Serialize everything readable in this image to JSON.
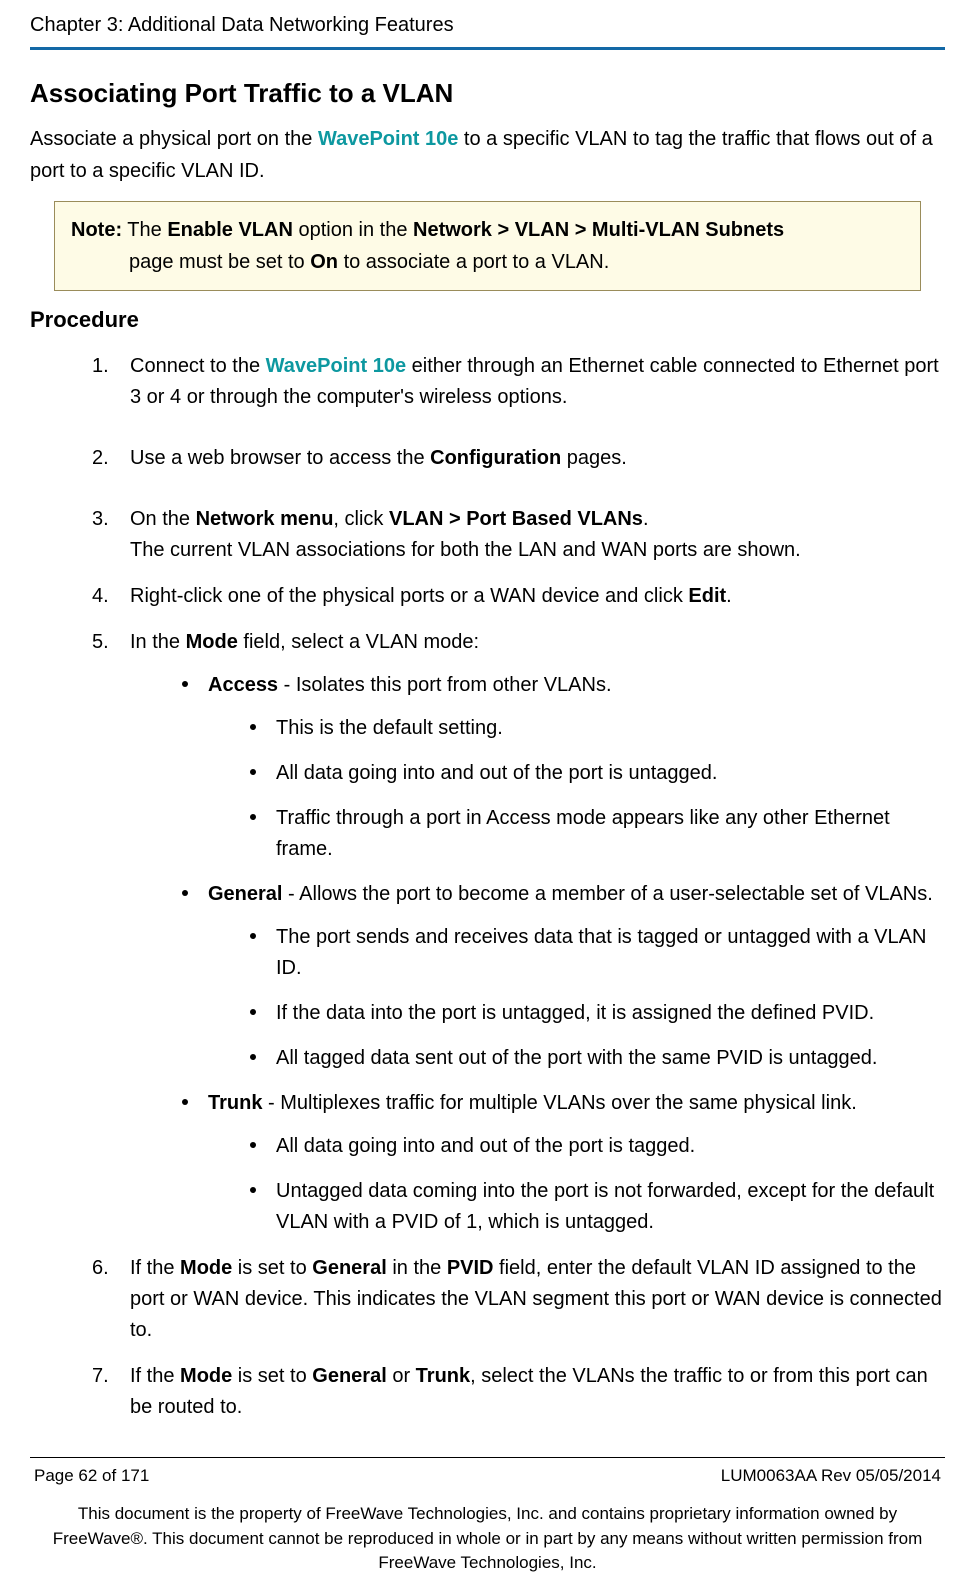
{
  "header": {
    "chapter": "Chapter 3: Additional Data Networking Features"
  },
  "section": {
    "title": "Associating Port Traffic to a VLAN",
    "intro_pre": "Associate a physical port on the ",
    "intro_link": "WavePoint 10e",
    "intro_post": " to a specific VLAN to tag the traffic that flows out of a port to a specific VLAN ID."
  },
  "note": {
    "label": "Note:",
    "line1_a": " The ",
    "line1_b": "Enable VLAN",
    "line1_c": " option in the ",
    "line1_d": "Network > VLAN > Multi-VLAN Subnets",
    "line2_a": "page must be set to ",
    "line2_b": "On",
    "line2_c": " to associate a port to a VLAN."
  },
  "procedure": {
    "title": "Procedure",
    "steps": {
      "s1": {
        "num": "1.",
        "a": "Connect to the ",
        "link": "WavePoint 10e",
        "b": " either through an Ethernet cable connected to Ethernet port 3 or 4 or through the computer's wireless options."
      },
      "s2": {
        "num": "2.",
        "a": "Use a web browser to access the ",
        "b": "Configuration",
        "c": " pages."
      },
      "s3": {
        "num": "3.",
        "a": "On the ",
        "b": "Network menu",
        "c": ", click ",
        "d": "VLAN > Port Based VLANs",
        "e": ".",
        "line2": "The current VLAN associations for both the LAN and WAN ports are shown."
      },
      "s4": {
        "num": "4.",
        "a": "Right-click one of the physical ports or a WAN device and click ",
        "b": "Edit",
        "c": "."
      },
      "s5": {
        "num": "5.",
        "a": "In the ",
        "b": "Mode",
        "c": " field, select a VLAN mode:",
        "modes": {
          "access": {
            "label": "Access",
            "desc": " - Isolates this port from other VLANs.",
            "subs": {
              "i1": "This is the default setting.",
              "i2": "All data going into and out of the port is untagged.",
              "i3": "Traffic through a port in Access mode appears like any other Ethernet frame."
            }
          },
          "general": {
            "label": "General",
            "desc": " - Allows the port to become a member of a user-selectable set of VLANs.",
            "subs": {
              "i1": "The port sends and receives data that is tagged or untagged with a VLAN ID.",
              "i2": "If the data into the port is untagged, it is assigned the defined PVID.",
              "i3": "All tagged data sent out of the port with the same PVID is untagged."
            }
          },
          "trunk": {
            "label": "Trunk",
            "desc": " - Multiplexes traffic for multiple VLANs over the same physical link.",
            "subs": {
              "i1": "All data going into and out of the port is tagged.",
              "i2": "Untagged data coming into the port is not forwarded, except for the default VLAN with a PVID of 1, which is untagged."
            }
          }
        }
      },
      "s6": {
        "num": "6.",
        "a": "If the ",
        "b": "Mode",
        "c": " is set to ",
        "d": "General",
        "e": " in the ",
        "f": "PVID",
        "g": " field, enter the default VLAN ID assigned to the port or WAN device. This indicates the VLAN segment this port or WAN device is connected to."
      },
      "s7": {
        "num": "7.",
        "a": "If the ",
        "b": "Mode",
        "c": " is set to ",
        "d": "General",
        "e": " or ",
        "f": "Trunk",
        "g": ", select the VLANs the traffic to or from this port can be routed to."
      }
    }
  },
  "footer": {
    "page": "Page 62 of 171",
    "doc_rev": "LUM0063AA Rev 05/05/2014",
    "legal": "This document is the property of FreeWave Technologies, Inc. and contains proprietary information owned by FreeWave®. This document cannot be reproduced in whole or in part by any means without written permission from FreeWave Technologies, Inc."
  }
}
